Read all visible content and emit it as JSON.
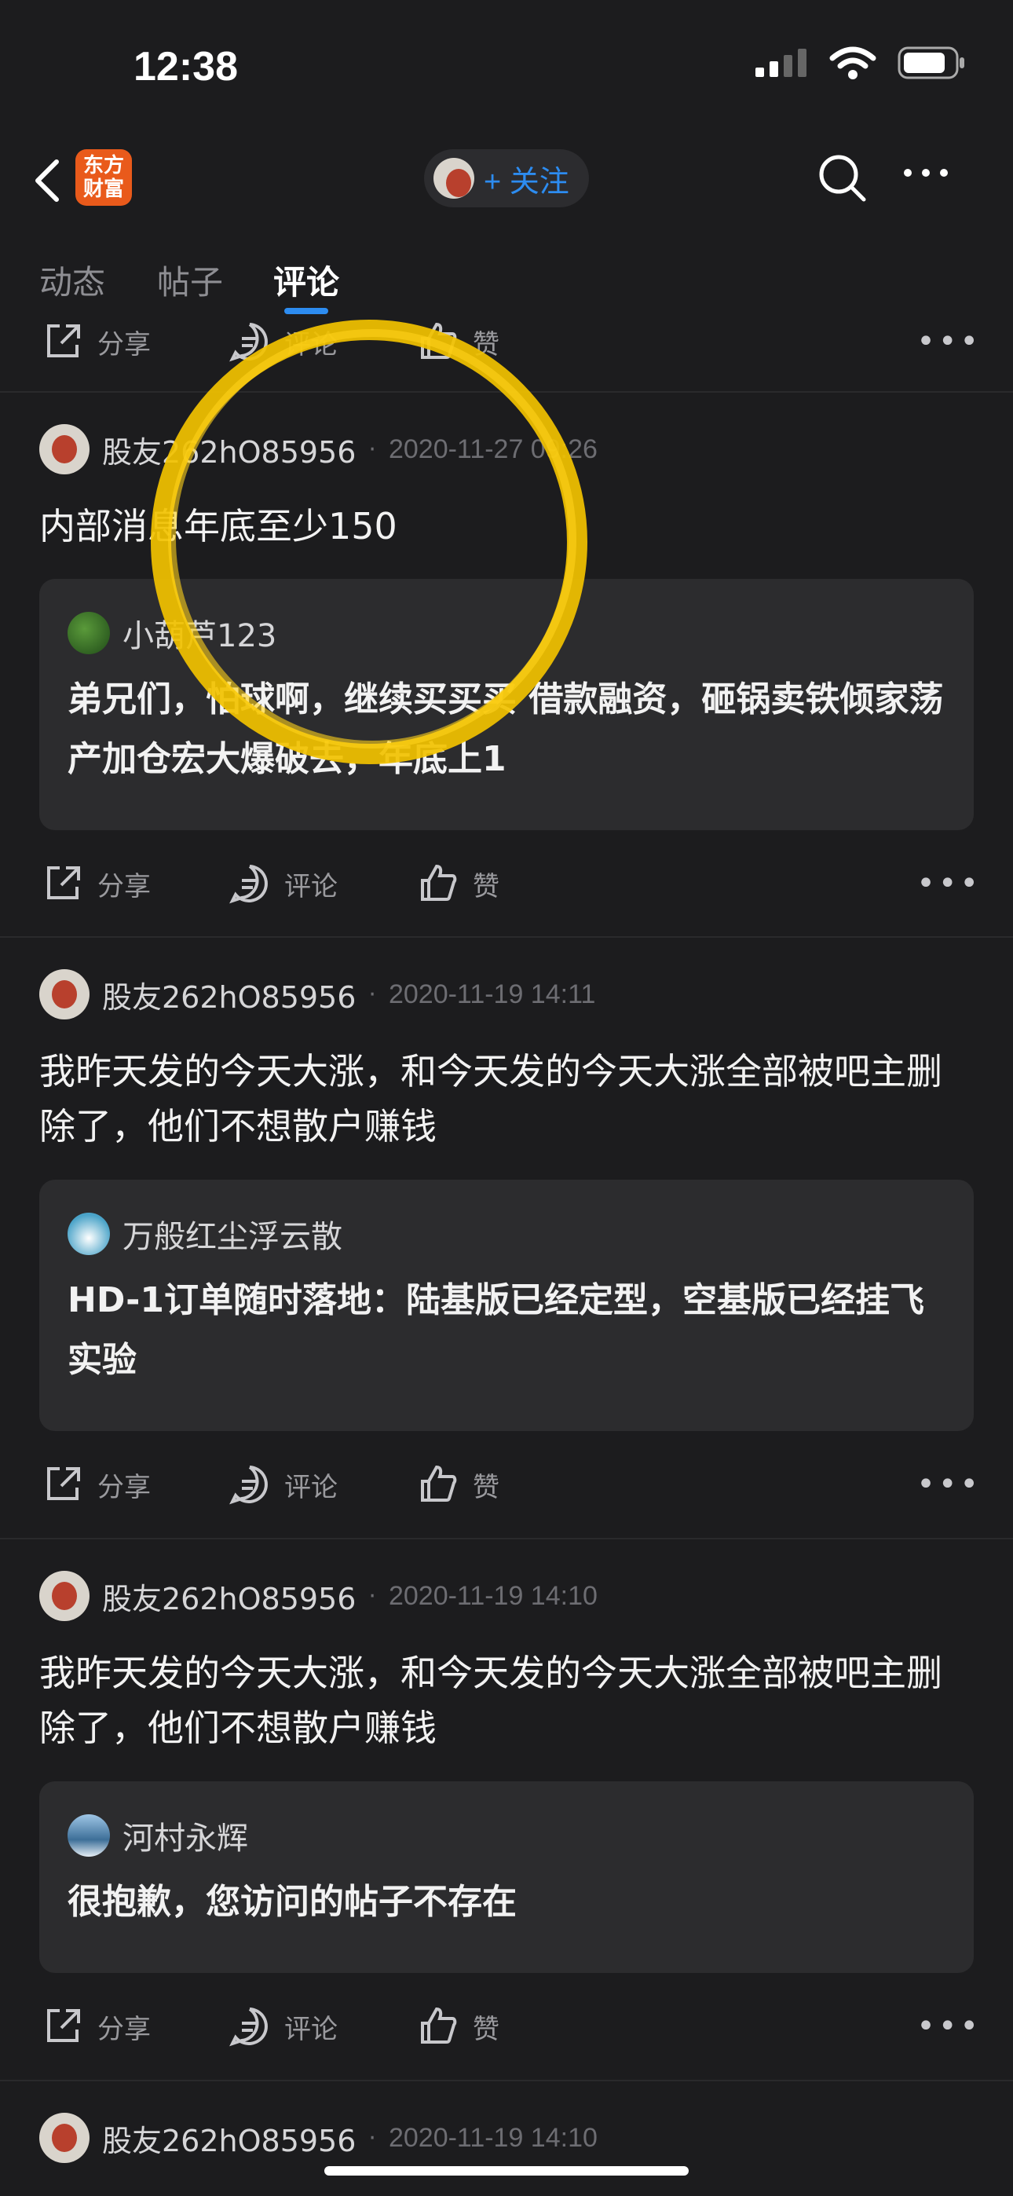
{
  "status_bar": {
    "time": "12:38"
  },
  "nav": {
    "logo_line1": "东方",
    "logo_line2": "财富",
    "follow_label": "+ 关注"
  },
  "tabs": [
    {
      "label": "动态"
    },
    {
      "label": "帖子"
    },
    {
      "label": "评论",
      "active": true
    }
  ],
  "actions": {
    "share": "分享",
    "comment": "评论",
    "like": "赞",
    "more": "•••"
  },
  "posts": [
    {
      "user": "股友262hO85956",
      "time": "2020-11-27 09:26",
      "text": "内部消息年底至少150",
      "quote": {
        "user": "小葫芦123",
        "text": "弟兄们，怕球啊，继续买买买 借款融资，砸锅卖铁倾家荡产加仓宏大爆破去，年底上1"
      }
    },
    {
      "user": "股友262hO85956",
      "time": "2020-11-19 14:11",
      "text": "我昨天发的今天大涨，和今天发的今天大涨全部被吧主删除了，他们不想散户赚钱",
      "quote": {
        "user": "万般红尘浮云散",
        "text": "HD-1订单随时落地：陆基版已经定型，空基版已经挂飞实验"
      }
    },
    {
      "user": "股友262hO85956",
      "time": "2020-11-19 14:10",
      "text": "我昨天发的今天大涨，和今天发的今天大涨全部被吧主删除了，他们不想散户赚钱",
      "quote": {
        "user": "河村永辉",
        "text": "很抱歉，您访问的帖子不存在"
      }
    },
    {
      "user": "股友262hO85956",
      "time": "2020-11-19 14:10"
    }
  ],
  "colors": {
    "background": "#1c1c1e",
    "accent": "#2d8cf0",
    "annotation": "#f2c200",
    "logo": "#e95a1b"
  }
}
